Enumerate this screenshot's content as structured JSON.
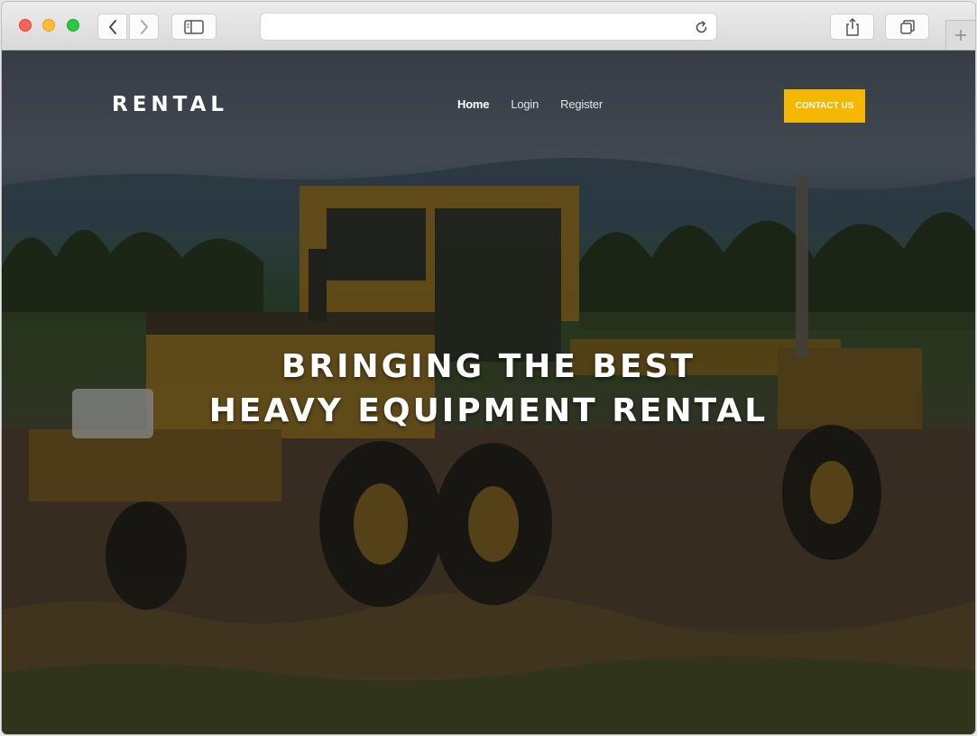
{
  "browser": {
    "url": "",
    "icons": {
      "back": "chevron-left-icon",
      "forward": "chevron-right-icon",
      "sidebar": "sidebar-icon",
      "reload": "reload-icon",
      "share": "share-icon",
      "tabs": "tabs-icon",
      "new_tab": "plus-icon"
    }
  },
  "site": {
    "brand": "RENTAL",
    "nav": [
      {
        "label": "Home"
      },
      {
        "label": "Login"
      },
      {
        "label": "Register"
      }
    ],
    "contact_button": "CONTACT US",
    "hero": {
      "line1": "BRINGING THE BEST",
      "line2": "HEAVY EQUIPMENT RENTAL"
    }
  },
  "colors": {
    "accent": "#f6b700",
    "hero_text": "#ffffff"
  }
}
